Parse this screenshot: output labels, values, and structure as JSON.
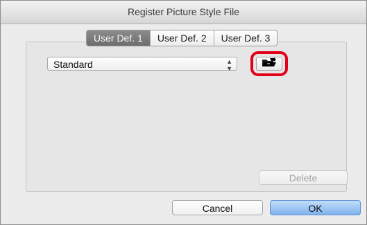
{
  "dialog": {
    "title": "Register Picture Style File"
  },
  "tabs": [
    {
      "label": "User Def. 1",
      "active": true
    },
    {
      "label": "User Def. 2",
      "active": false
    },
    {
      "label": "User Def. 3",
      "active": false
    }
  ],
  "style_select": {
    "value": "Standard"
  },
  "buttons": {
    "load_icon": "open-folder-icon",
    "delete_label": "Delete",
    "cancel_label": "Cancel",
    "ok_label": "OK"
  },
  "colors": {
    "highlight": "#e3001b",
    "ok_button": "#7fb3ee",
    "active_tab": "#7a7a7a"
  }
}
